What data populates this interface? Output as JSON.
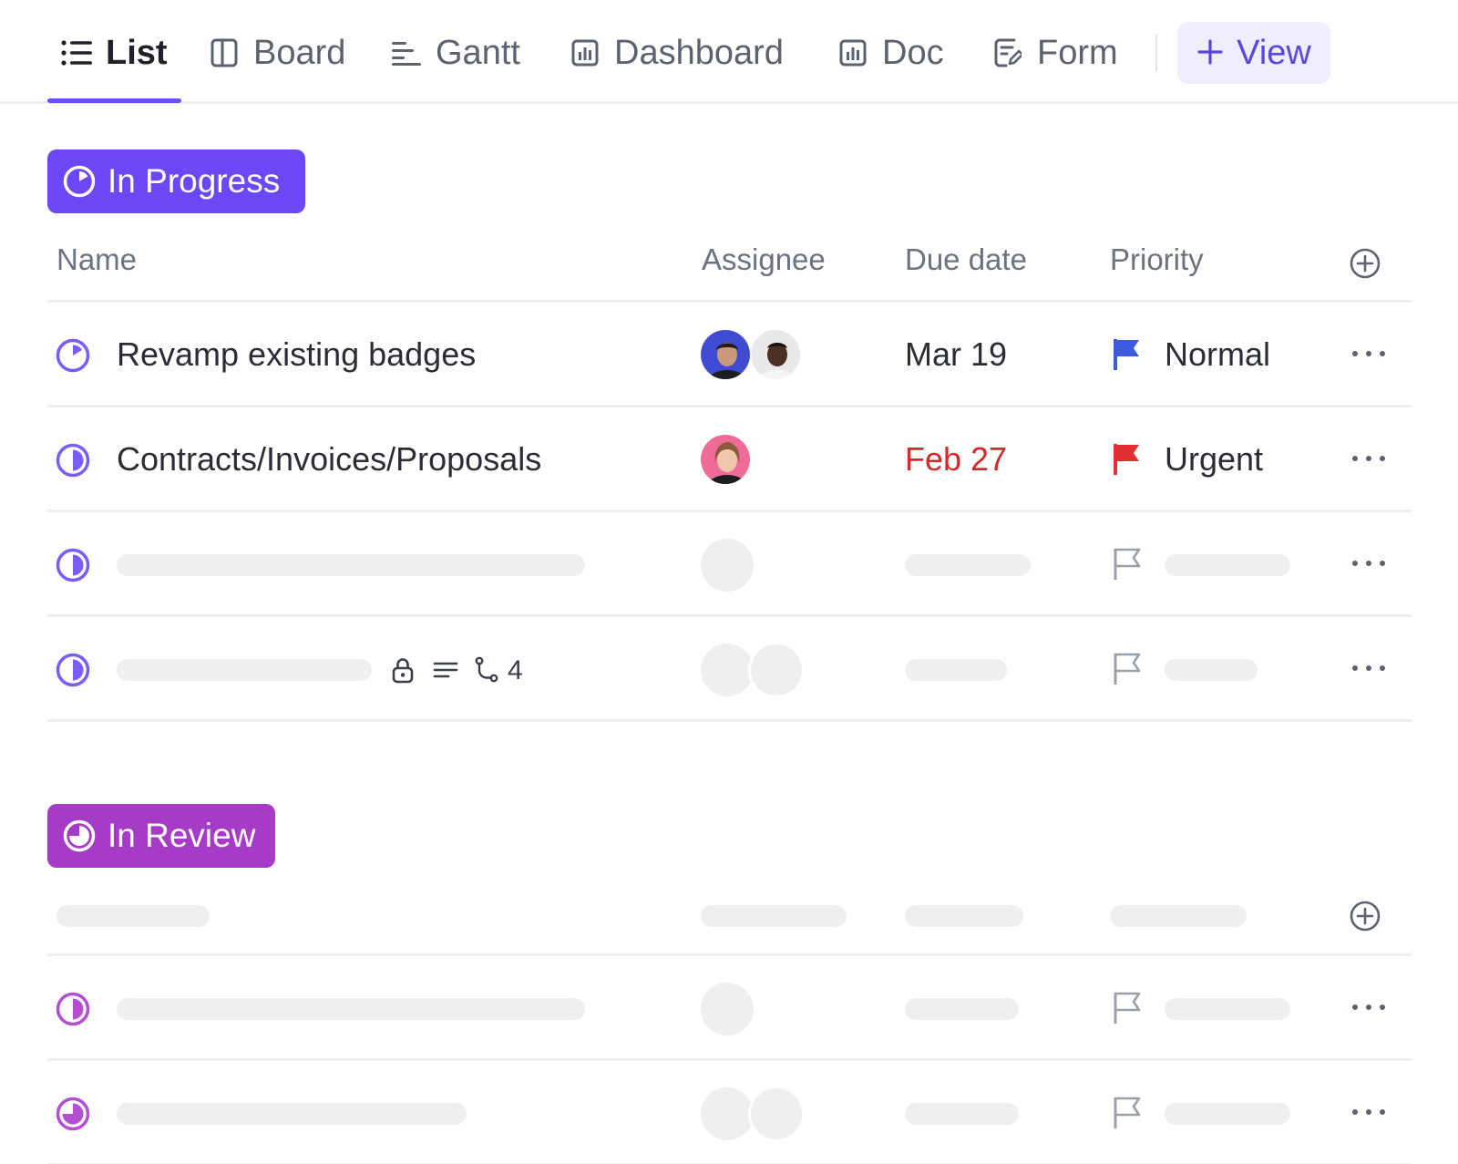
{
  "tabs": [
    {
      "label": "List",
      "icon": "list-icon",
      "active": true
    },
    {
      "label": "Board",
      "icon": "board-icon"
    },
    {
      "label": "Gantt",
      "icon": "gantt-icon"
    },
    {
      "label": "Dashboard",
      "icon": "dashboard-icon"
    },
    {
      "label": "Doc",
      "icon": "doc-icon"
    },
    {
      "label": "Form",
      "icon": "form-icon"
    }
  ],
  "add_view": {
    "label": "View",
    "icon": "plus-icon"
  },
  "groups": {
    "in_progress": {
      "label": "In Progress",
      "color": "#6c47f5",
      "columns": {
        "name": "Name",
        "assignee": "Assignee",
        "due_date": "Due date",
        "priority": "Priority"
      },
      "tasks": [
        {
          "name": "Revamp existing badges",
          "assignees": 2,
          "due": "Mar 19",
          "priority": "Normal",
          "flag_color": "#3b5bdb"
        },
        {
          "name": "Contracts/Invoices/Proposals",
          "assignees": 1,
          "due": "Feb 27",
          "due_color": "#d32a2a",
          "priority": "Urgent",
          "flag_color": "#e03131"
        }
      ],
      "meta": {
        "subtask_count": "4"
      }
    },
    "in_review": {
      "label": "In Review",
      "color": "#a63bc8"
    }
  },
  "colors": {
    "accent": "#6b4ff6",
    "view_button_bg": "#eeeefe",
    "skeleton": "#efefef",
    "divider": "#eceef1"
  }
}
